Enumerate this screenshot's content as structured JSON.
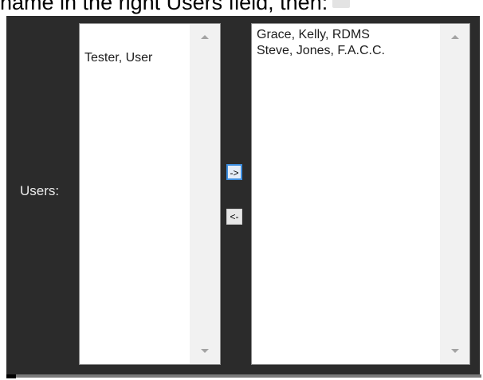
{
  "caption": {
    "text": "name in the right Users field, then:"
  },
  "users_label": "Users:",
  "available_list": {
    "items": [
      "Tester, User"
    ]
  },
  "selected_list": {
    "items": [
      "Grace, Kelly, RDMS",
      "Steve, Jones, F.A.C.C."
    ]
  },
  "buttons": {
    "move_right": "->",
    "move_left": "<-"
  },
  "colors": {
    "panel_background": "#2b2b2b",
    "label_text": "#ececec",
    "listbox_background": "#ffffff",
    "scrollbar_track": "#f1f1f1",
    "focused_button_border": "#3d8ee0"
  },
  "icons": {
    "scroll_up": "triangle-up-icon",
    "scroll_down": "triangle-down-icon",
    "caption_trailing": "image-placeholder-icon"
  }
}
